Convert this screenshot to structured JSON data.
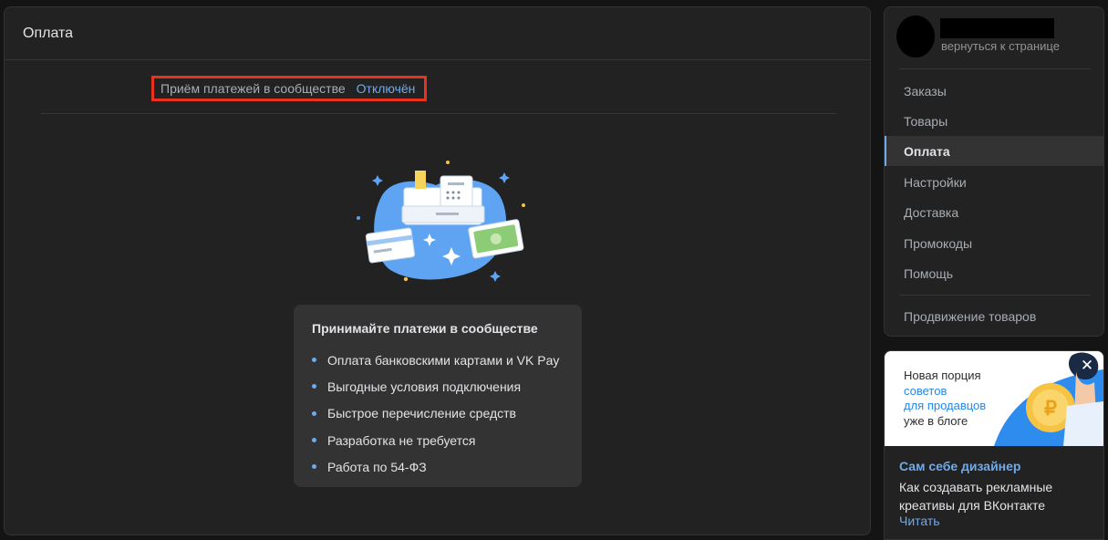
{
  "main": {
    "title": "Оплата",
    "status_label": "Приём платежей в сообществе",
    "status_value": "Отключён",
    "info": {
      "title": "Принимайте платежи в сообществе",
      "items": [
        "Оплата банковскими картами и VK Pay",
        "Выгодные условия подключения",
        "Быстрое перечисление средств",
        "Разработка не требуется",
        "Работа по 54-ФЗ"
      ]
    }
  },
  "sidebar": {
    "back_link": "вернуться к странице",
    "items": [
      {
        "label": "Заказы"
      },
      {
        "label": "Товары"
      },
      {
        "label": "Оплата",
        "active": true
      },
      {
        "label": "Настройки"
      },
      {
        "label": "Доставка"
      },
      {
        "label": "Промокоды"
      },
      {
        "label": "Помощь"
      }
    ],
    "promo_item": "Продвижение товаров"
  },
  "ad": {
    "banner_line1": "Новая порция",
    "banner_line2": "советов",
    "banner_line3": "для продавцов",
    "banner_line4": "уже в блоге",
    "title": "Сам себе дизайнер",
    "description": "Как создавать рекламные креативы для ВКонтакте",
    "read_link": "Читать"
  },
  "colors": {
    "accent": "#71aaeb",
    "highlight_border": "#e8321e",
    "background": "#141414",
    "panel": "#222222"
  }
}
